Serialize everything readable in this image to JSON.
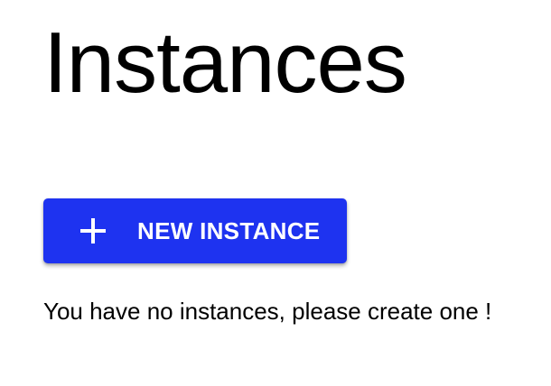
{
  "page": {
    "title": "Instances",
    "empty_message": "You have no instances, please create one !"
  },
  "actions": {
    "new_instance_label": "NEW INSTANCE",
    "new_instance_icon": "plus-icon"
  },
  "colors": {
    "primary": "#1e33f0",
    "background": "#ffffff",
    "text": "#000000",
    "button_text": "#ffffff"
  }
}
